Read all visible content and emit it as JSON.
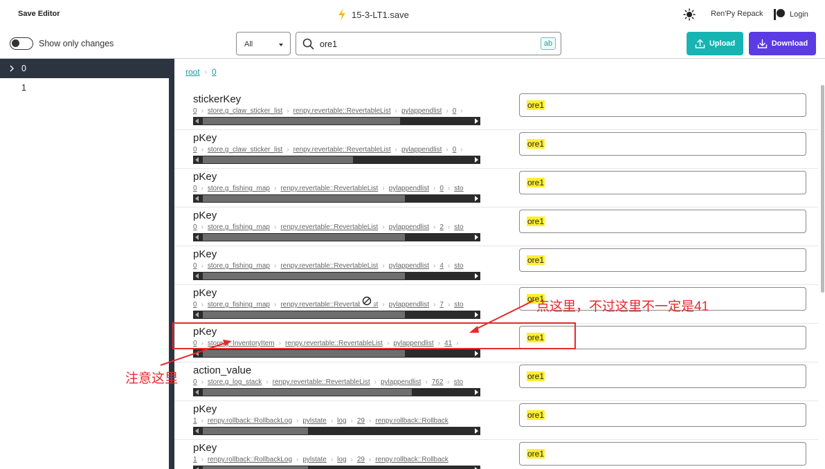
{
  "header": {
    "app_title": "Save Editor",
    "file_name": "15-3-LT1.save",
    "repack_label": "Ren'Py Repack",
    "login_label": "Login",
    "icons": {
      "file": "lightning-icon",
      "theme": "sun-icon",
      "login": "patreon-icon"
    },
    "accent_color": "#f0c020"
  },
  "toolbar": {
    "toggle_label": "Show only changes",
    "filter_value": "All",
    "search_value": "ore1",
    "regex_label": "ab",
    "upload_label": "Upload",
    "download_label": "Download",
    "upload_color": "#17b4b4",
    "download_color": "#5b3be3"
  },
  "sidebar": {
    "items": [
      {
        "label": "0",
        "selected": true
      },
      {
        "label": "1",
        "selected": false
      }
    ]
  },
  "breadcrumb": {
    "root": "root",
    "current": "0"
  },
  "rows": [
    {
      "key": "stickerKey",
      "path": [
        "0",
        "store.g_claw_sticker_list",
        "renpy.revertable::RevertableList",
        "pylappendlist",
        "0",
        ""
      ],
      "value": "ore1"
    },
    {
      "key": "pKey",
      "path": [
        "0",
        "store.g_claw_sticker_list",
        "renpy.revertable::RevertableList",
        "pylappendlist",
        "0",
        ""
      ],
      "value": "ore1"
    },
    {
      "key": "pKey",
      "path": [
        "0",
        "store.g_fishing_map",
        "renpy.revertable::RevertableList",
        "pylappendlist",
        "0",
        "sto"
      ],
      "value": "ore1"
    },
    {
      "key": "pKey",
      "path": [
        "0",
        "store.g_fishing_map",
        "renpy.revertable::RevertableList",
        "pylappendlist",
        "2",
        "sto"
      ],
      "value": "ore1"
    },
    {
      "key": "pKey",
      "path": [
        "0",
        "store.g_fishing_map",
        "renpy.revertable::RevertableList",
        "pylappendlist",
        "4",
        "sto"
      ],
      "value": "ore1"
    },
    {
      "key": "pKey",
      "path": [
        "0",
        "store.g_fishing_map",
        "renpy.revertable::RevertableList",
        "pylappendlist",
        "7",
        "sto"
      ],
      "value": "ore1"
    },
    {
      "key": "pKey",
      "path": [
        "0",
        "store.g_InventoryItem",
        "renpy.revertable::RevertableList",
        "pylappendlist",
        "41",
        ""
      ],
      "value": "ore1"
    },
    {
      "key": "action_value",
      "path": [
        "0",
        "store.g_log_stack",
        "renpy.revertable::RevertableList",
        "pylappendlist",
        "762",
        "sto"
      ],
      "value": "ore1"
    },
    {
      "key": "pKey",
      "path": [
        "1",
        "renpy.rollback::RollbackLog",
        "pylstate",
        "log",
        "29",
        "renpy.rollback::Rollback"
      ],
      "value": "ore1"
    },
    {
      "key": "pKey",
      "path": [
        "1",
        "renpy.rollback::RollbackLog",
        "pylstate",
        "log",
        "29",
        "renpy.rollback::Rollback"
      ],
      "value": "ore1"
    }
  ],
  "annotations": {
    "text1": "点这里，不过这里不一定是41",
    "text2": "注意这里",
    "color": "#e8282b"
  }
}
